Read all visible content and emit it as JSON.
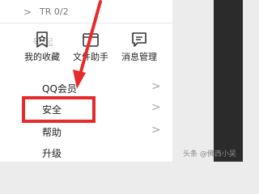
{
  "top_row": {
    "chevron": ">",
    "text": "TR 0/2"
  },
  "faded_text": "号 起",
  "quick_actions": [
    {
      "label": "我的收藏",
      "icon": "bookmark-icon"
    },
    {
      "label": "文件助手",
      "icon": "folder-icon"
    },
    {
      "label": "消息管理",
      "icon": "message-icon"
    }
  ],
  "menu": {
    "items": [
      {
        "label": "QQ会员"
      },
      {
        "label": "安全"
      },
      {
        "label": "帮助"
      },
      {
        "label": "升级"
      }
    ],
    "arrow_glyph": ">"
  },
  "annotation": {
    "highlight_color": "#e52b2b"
  },
  "watermark": "头条 @佛西小吴"
}
